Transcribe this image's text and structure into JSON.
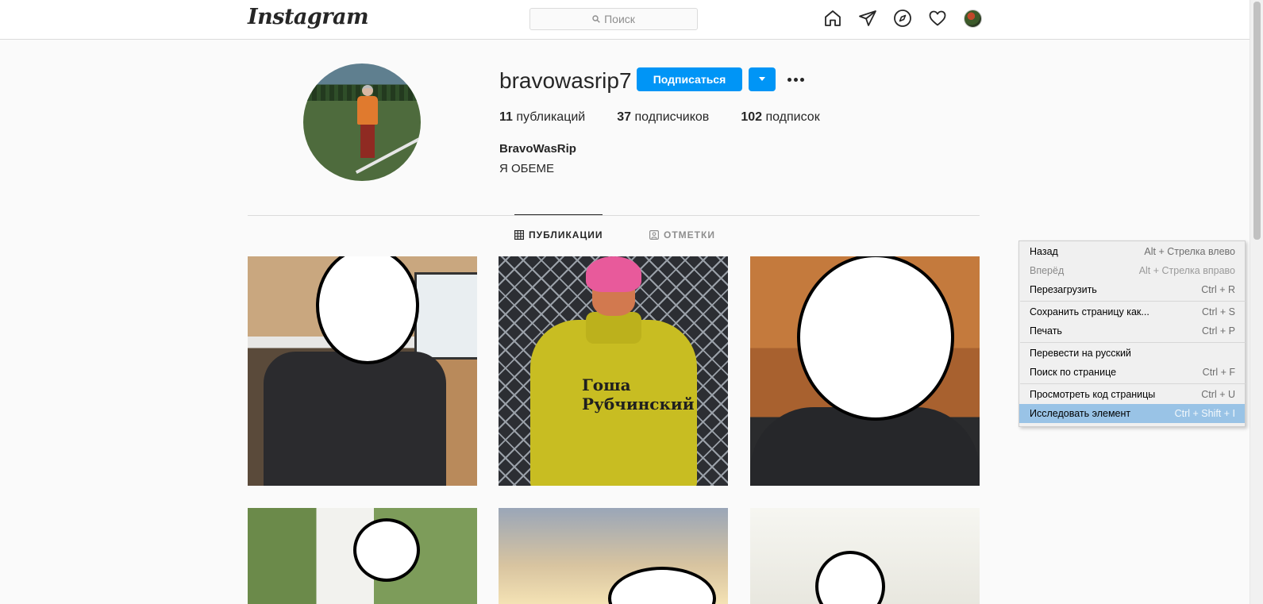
{
  "nav": {
    "logo": "Instagram",
    "search_placeholder": "Поиск"
  },
  "profile": {
    "username": "bravowasrip7",
    "follow_label": "Подписаться",
    "stats": {
      "posts_count": "11",
      "posts_label": "публикаций",
      "followers_count": "37",
      "followers_label": "подписчиков",
      "following_count": "102",
      "following_label": "подписок"
    },
    "full_name": "BravoWasRip",
    "bio": "Я ОБЕМЕ"
  },
  "tabs": {
    "posts": "ПУБЛИКАЦИИ",
    "tagged": "ОТМЕТКИ",
    "active": "posts"
  },
  "posts": [
    {
      "shirt_text": ""
    },
    {
      "shirt_text": "Гоша Рубчинский"
    },
    {
      "shirt_text": ""
    },
    {
      "shirt_text": ""
    },
    {
      "shirt_text": ""
    },
    {
      "shirt_text": ""
    }
  ],
  "context_menu": {
    "items": [
      {
        "label": "Назад",
        "shortcut": "Alt + Стрелка влево",
        "enabled": true
      },
      {
        "label": "Вперёд",
        "shortcut": "Alt + Стрелка вправо",
        "enabled": false
      },
      {
        "label": "Перезагрузить",
        "shortcut": "Ctrl + R",
        "enabled": true
      },
      {
        "label": "Сохранить страницу как...",
        "shortcut": "Ctrl + S",
        "enabled": true
      },
      {
        "label": "Печать",
        "shortcut": "Ctrl + P",
        "enabled": true
      },
      {
        "label": "Перевести на русский",
        "shortcut": "",
        "enabled": true
      },
      {
        "label": "Поиск по странице",
        "shortcut": "Ctrl + F",
        "enabled": true
      },
      {
        "label": "Просмотреть код страницы",
        "shortcut": "Ctrl + U",
        "enabled": true
      },
      {
        "label": "Исследовать элемент",
        "shortcut": "Ctrl + Shift + I",
        "enabled": true,
        "highlighted": true
      }
    ]
  },
  "colors": {
    "accent": "#0095f6",
    "menu_highlight": "#99c3e6"
  },
  "icons": [
    "search-icon",
    "home-icon",
    "direct-icon",
    "explore-icon",
    "heart-icon",
    "grid-icon",
    "tagged-icon",
    "chevron-down-icon",
    "more-icon"
  ]
}
